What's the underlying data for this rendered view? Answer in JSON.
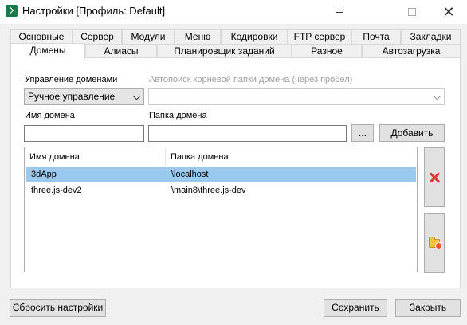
{
  "window": {
    "title": "Настройки [Профиль: Default]"
  },
  "tabs_row1": [
    "Основные",
    "Сервер",
    "Модули",
    "Меню",
    "Кодировки",
    "FTP сервер",
    "Почта",
    "Закладки"
  ],
  "tabs_row2": [
    "Домены",
    "Алиасы",
    "Планировщик заданий",
    "Разное",
    "Автозагрузка"
  ],
  "active_tab": "Домены",
  "domains": {
    "management_label": "Управление доменами",
    "management_value": "Ручное управление",
    "autosearch_label": "Автопоиск корневой папки домена (через пробел)",
    "autosearch_value": "",
    "domain_name_label": "Имя домена",
    "domain_name_value": "",
    "domain_folder_label": "Папка домена",
    "domain_folder_value": "",
    "browse_label": "...",
    "add_label": "Добавить",
    "table": {
      "headers": [
        "Имя домена",
        "Папка домена"
      ],
      "rows": [
        {
          "name": "3dApp",
          "folder": "\\localhost",
          "selected": true
        },
        {
          "name": "three.js-dev2",
          "folder": "\\main8\\three.js-dev",
          "selected": false
        }
      ]
    },
    "delete_icon": "red-x-icon",
    "add_folder_icon": "folder-add-icon"
  },
  "footer": {
    "reset_label": "Сбросить настройки",
    "save_label": "Сохранить",
    "close_label": "Закрыть"
  },
  "colors": {
    "selection": "#99c9ef",
    "delete": "#e03b3b",
    "app_icon": "#1a7a4c"
  }
}
